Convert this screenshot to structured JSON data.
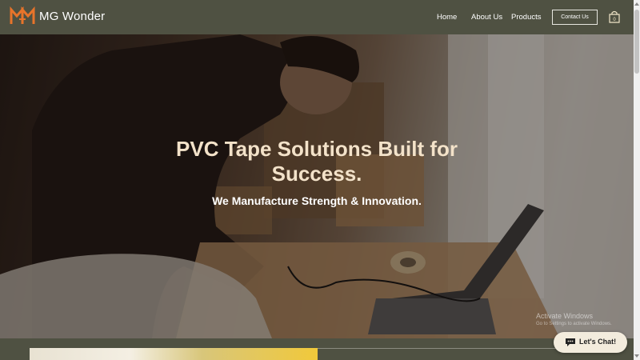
{
  "header": {
    "brand": "MG Wonder",
    "logo_icon": "mg-logo-icon",
    "nav": [
      {
        "label": "Home"
      },
      {
        "label": "About Us"
      },
      {
        "label": "Products"
      }
    ],
    "contact_label": "Contact Us",
    "cart_count": "0",
    "cart_icon": "shopping-bag-icon"
  },
  "hero": {
    "title": "PVC Tape Solutions Built for Success.",
    "subtitle": "We Manufacture Strength & Innovation."
  },
  "watermark": {
    "line1": "Activate Windows",
    "line2": "Go to Settings to activate Windows."
  },
  "chat": {
    "label": "Let's Chat!",
    "icon": "chat-bubble-icon"
  },
  "colors": {
    "header_bg": "#4f5142",
    "logo_accent": "#e8742a",
    "hero_title": "#f3e2c9",
    "chat_bg": "#f3ecdd"
  }
}
